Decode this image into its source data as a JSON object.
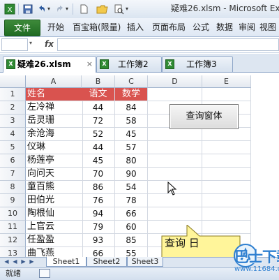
{
  "title_bar": {
    "doc_title": "疑难26.xlsm - Microsoft Ex"
  },
  "ribbon": {
    "file_label": "文件",
    "tabs": [
      "开始",
      "百宝箱(限量)",
      "插入",
      "页面布局",
      "公式",
      "数据",
      "审阅",
      "视图"
    ]
  },
  "formula_bar": {
    "fx_label": "fx"
  },
  "workbook_tabs": [
    {
      "label": "疑难26.xlsm",
      "close": "×",
      "active": true
    },
    {
      "label": "工作簿2",
      "active": false
    },
    {
      "label": "工作簿3",
      "active": false
    }
  ],
  "columns": [
    "A",
    "B",
    "C",
    "D",
    "E"
  ],
  "rows": [
    "1",
    "2",
    "3",
    "4",
    "5",
    "6",
    "7",
    "8",
    "9",
    "10",
    "11",
    "12",
    "13"
  ],
  "table": {
    "header": [
      "姓名",
      "语文",
      "数学"
    ],
    "data": [
      [
        "左冷禅",
        "44",
        "84"
      ],
      [
        "岳灵珊",
        "72",
        "58"
      ],
      [
        "余沧海",
        "52",
        "45"
      ],
      [
        "仪琳",
        "44",
        "57"
      ],
      [
        "杨莲亭",
        "45",
        "80"
      ],
      [
        "向问天",
        "70",
        "90"
      ],
      [
        "童百熊",
        "86",
        "54"
      ],
      [
        "田伯光",
        "76",
        "78"
      ],
      [
        "陶根仙",
        "94",
        "66"
      ],
      [
        "上官云",
        "79",
        "60"
      ],
      [
        "任盈盈",
        "93",
        "85"
      ],
      [
        "曲飞燕",
        "66",
        "55"
      ]
    ],
    "header_color": "#d9534f"
  },
  "button": {
    "label": "查询窗体"
  },
  "callout": {
    "text": "查询    日"
  },
  "sheet_tabs": [
    "Sheet1",
    "Sheet2",
    "Sheet3"
  ],
  "status": {
    "text": "就绪"
  },
  "watermark": {
    "text": "巴士下载",
    "url": "www.11684.com"
  },
  "colors": {
    "accent_file_tab": "#1f6b22",
    "callout_fill": "#fff59a"
  }
}
